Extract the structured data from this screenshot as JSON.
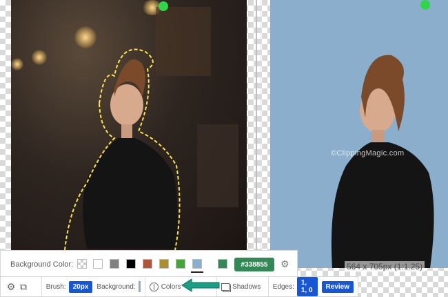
{
  "canvas": {
    "size_readout": "564 x 705px (1:1.25)",
    "watermark": "©ClippingMagic.com"
  },
  "color_panel": {
    "label": "Background Color:",
    "swatches": [
      {
        "name": "transparent-swatch",
        "color": "transparent"
      },
      {
        "name": "white-swatch",
        "color": "#ffffff"
      },
      {
        "name": "gray-swatch",
        "color": "#808080"
      },
      {
        "name": "black-swatch",
        "color": "#000000"
      },
      {
        "name": "rust-swatch",
        "color": "#b0553b"
      },
      {
        "name": "olive-swatch",
        "color": "#a89030"
      },
      {
        "name": "green-swatch",
        "color": "#45a53a"
      },
      {
        "name": "light-blue-swatch",
        "color": "#8aaecb",
        "selected": true
      }
    ],
    "custom_color": "#338855",
    "custom_hex": "#338855"
  },
  "toolbar": {
    "brush_label": "Brush:",
    "brush_value": "20px",
    "background_label": "Background:",
    "background_chip_color": "#8aaecb",
    "colors_label": "Colors",
    "shadows_label": "Shadows",
    "edges_label": "Edges:",
    "edges_value": "1, 1, 0",
    "review_label": "Review"
  },
  "colors": {
    "accent_blue": "#1756d4",
    "arrow_teal": "#1a9e86",
    "selection_dash": "#ffe34d",
    "dot_green": "#2fd64a"
  }
}
